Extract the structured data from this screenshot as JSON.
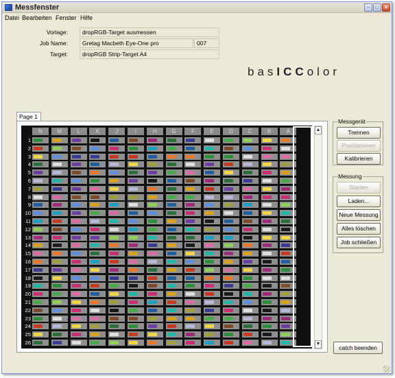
{
  "window": {
    "title": "Messfenster",
    "min_glyph": "–",
    "max_glyph": "□",
    "close_glyph": "×"
  },
  "menu": [
    "Datei",
    "Bearbeiten",
    "Fenster",
    "Hilfe"
  ],
  "form": {
    "vorlage_label": "Vorlage:",
    "vorlage_value": "dropRGB-Target ausmessen",
    "jobname_label": "Job Name:",
    "jobname_value": "Gretag Macbeth Eye-One pro",
    "jobname_number": "007",
    "target_label": "Target:",
    "target_value": "dropRGB Strip-Target A4"
  },
  "logo": {
    "part1": "bas",
    "part2": "ICC",
    "part3": "olor"
  },
  "tab": {
    "label": "Page 1"
  },
  "grid": {
    "columns": [
      "N",
      "M",
      "L",
      "K",
      "J",
      "I",
      "H",
      "G",
      "F",
      "E",
      "D",
      "C",
      "B",
      "A"
    ],
    "rows": [
      "1",
      "2",
      "3",
      "4",
      "5",
      "6",
      "7",
      "8",
      "9",
      "10",
      "11",
      "12",
      "13",
      "14",
      "15",
      "16",
      "17",
      "18",
      "19",
      "20",
      "21",
      "22",
      "23",
      "24",
      "25",
      "26"
    ],
    "selected_column": "A"
  },
  "palette": [
    "#2e8b3a",
    "#c62f73",
    "#3a3a8f",
    "#d9a21e",
    "#1f9fbf",
    "#e0e0e0",
    "#6b3fa0",
    "#c23b22",
    "#4aa84a",
    "#1a1a1a",
    "#d96fa6",
    "#8fcf5a",
    "#215c9c",
    "#b8b8d8",
    "#f2d64a",
    "#7d4b2a",
    "#23b5a5",
    "#e87a2d",
    "#9e2b7a",
    "#5f8fdb",
    "#a0a040",
    "#2a6e3b"
  ],
  "messgeraet": {
    "legend": "Messgerät",
    "trennen": "Trennen",
    "positionieren": "Positionieren",
    "kalibrieren": "Kalibrieren"
  },
  "messung": {
    "legend": "Messung",
    "starten": "Starten",
    "laden": "Laden...",
    "neue_messung": "Neue Messung",
    "alles_loeschen": "Alles löschen",
    "job_schliessen": "Job schließen"
  },
  "catch_beenden": "catch beenden",
  "scroll": {
    "up": "▲",
    "down": "▼"
  }
}
